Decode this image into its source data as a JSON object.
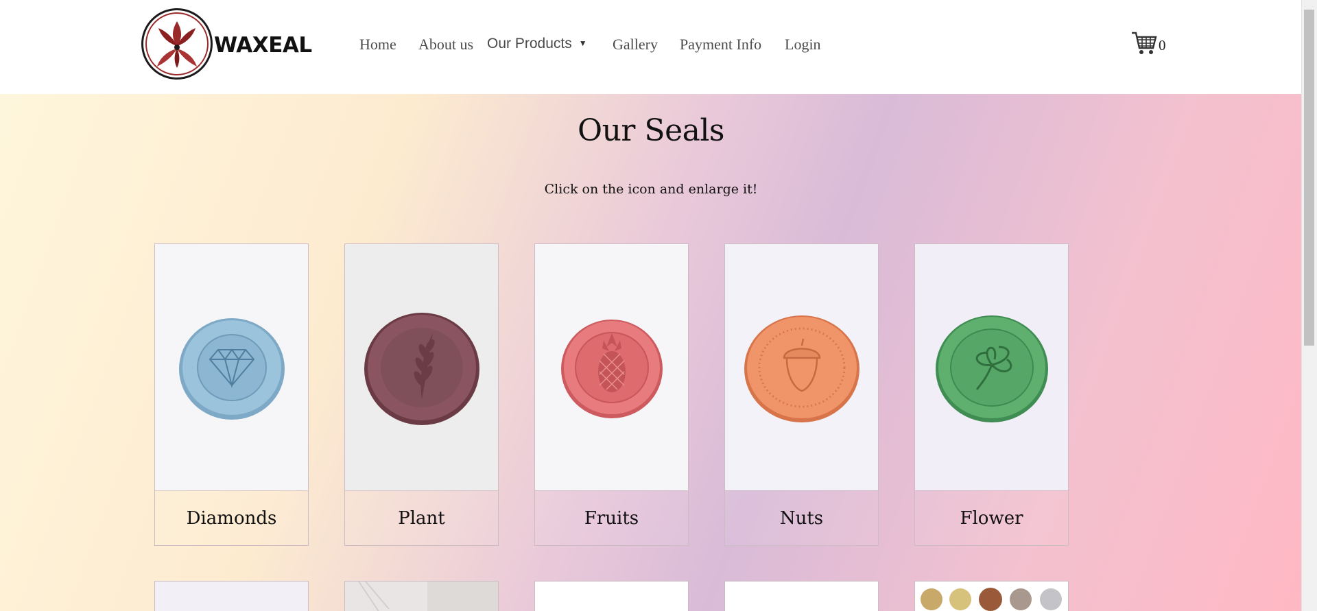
{
  "brand": {
    "name": "WAXEAL",
    "logo_icon": "lotus-flower-logo"
  },
  "nav": {
    "items": [
      {
        "label": "Home"
      },
      {
        "label": "About us"
      },
      {
        "label": "Our Products",
        "has_dropdown": true
      },
      {
        "label": "Gallery"
      },
      {
        "label": "Payment Info"
      },
      {
        "label": "Login"
      }
    ],
    "cart": {
      "icon": "shopping-cart-icon",
      "count": "0"
    }
  },
  "page": {
    "title": "Our Seals",
    "subtitle": "Click on the icon and enlarge it!"
  },
  "seals": [
    {
      "name": "Diamonds",
      "wax_color": "#8fb8d3",
      "emboss": "diamond-icon"
    },
    {
      "name": "Plant",
      "wax_color": "#7d4a52",
      "emboss": "wheat-leaf-icon"
    },
    {
      "name": "Fruits",
      "wax_color": "#df6e70",
      "emboss": "pineapple-icon"
    },
    {
      "name": "Nuts",
      "wax_color": "#e9895a",
      "emboss": "acorn-icon"
    },
    {
      "name": "Flower",
      "wax_color": "#58a86a",
      "emboss": "clover-icon"
    }
  ],
  "colors": {
    "nav_text": "#4a4a4a",
    "logo_accent": "#9a2a2a"
  }
}
